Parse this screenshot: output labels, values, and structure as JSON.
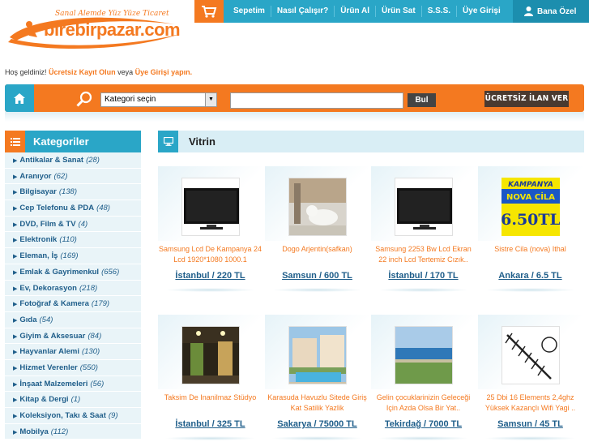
{
  "logo": {
    "slogan": "Sanal Alemde Yüz Yüze Ticaret",
    "name": "birebirpazar.com"
  },
  "topnav": {
    "links": [
      "Sepetim",
      "Nasıl Çalışır?",
      "Ürün Al",
      "Ürün Sat",
      "S.S.S.",
      "Üye Girişi"
    ],
    "user": "Bana Özel"
  },
  "welcome": {
    "prefix": "Hoş geldiniz!",
    "register": "Ücretsiz Kayıt Olun",
    "middle": "veya",
    "login": "Üye Girişi yapın."
  },
  "search": {
    "category_selected": "Kategori seçin",
    "query": "",
    "button": "Bul",
    "free_ad": "ÜCRETSİZ İLAN VER"
  },
  "sidebar": {
    "title": "Kategoriler",
    "items": [
      {
        "name": "Antikalar & Sanat",
        "count": "(28)"
      },
      {
        "name": "Aranıyor",
        "count": "(62)"
      },
      {
        "name": "Bilgisayar",
        "count": "(138)"
      },
      {
        "name": "Cep Telefonu & PDA",
        "count": "(48)"
      },
      {
        "name": "DVD, Film & TV",
        "count": "(4)"
      },
      {
        "name": "Elektronik",
        "count": "(110)"
      },
      {
        "name": "Eleman, İş",
        "count": "(169)"
      },
      {
        "name": "Emlak & Gayrimenkul",
        "count": "(656)"
      },
      {
        "name": "Ev, Dekorasyon",
        "count": "(218)"
      },
      {
        "name": "Fotoğraf & Kamera",
        "count": "(179)"
      },
      {
        "name": "Gıda",
        "count": "(54)"
      },
      {
        "name": "Giyim & Aksesuar",
        "count": "(84)"
      },
      {
        "name": "Hayvanlar Alemi",
        "count": "(130)"
      },
      {
        "name": "Hizmet Verenler",
        "count": "(550)"
      },
      {
        "name": "İnşaat Malzemeleri",
        "count": "(56)"
      },
      {
        "name": "Kitap & Dergi",
        "count": "(1)"
      },
      {
        "name": "Koleksiyon, Takı & Saat",
        "count": "(9)"
      },
      {
        "name": "Mobilya",
        "count": "(112)"
      }
    ]
  },
  "vitrin": {
    "title": "Vitrin",
    "cards": [
      {
        "title": "Samsung Lcd De Kampanya 24 Lcd 1920*1080 1000.1",
        "info": "İstanbul / 220 TL",
        "image": "tv"
      },
      {
        "title": "Dogo Arjentin(safkan)",
        "info": "Samsun / 600 TL",
        "image": "dog"
      },
      {
        "title": "Samsung 2253 Bw Lcd Ekran 22 inch Lcd Tertemiz Cızık..",
        "info": "İstanbul / 170 TL",
        "image": "tv"
      },
      {
        "title": "Sistre Cila (nova) Ithal",
        "info": "Ankara / 6.5 TL",
        "image": "ad"
      },
      {
        "title": "Taksim De Inanilmaz Stüdyo",
        "info": "İstanbul / 325 TL",
        "image": "studio"
      },
      {
        "title": "Karasuda Havuzlu Sitede Giriş Kat Satilik Yazlik",
        "info": "Sakarya / 75000 TL",
        "image": "pool"
      },
      {
        "title": "Gelin çocuklarinizin Geleceği Için Azda Olsa Bir Yat..",
        "info": "Tekirdağ / 7000 TL",
        "image": "sea"
      },
      {
        "title": "25 Dbi 16 Elements 2,4ghz Yüksek Kazançlı Wifi Yagi ..",
        "info": "Samsun / 45 TL",
        "image": "antenna"
      }
    ],
    "ad_text": {
      "top": "KAMPANYA",
      "mid": "NOVA CİLA",
      "price": "6.50TL"
    }
  }
}
